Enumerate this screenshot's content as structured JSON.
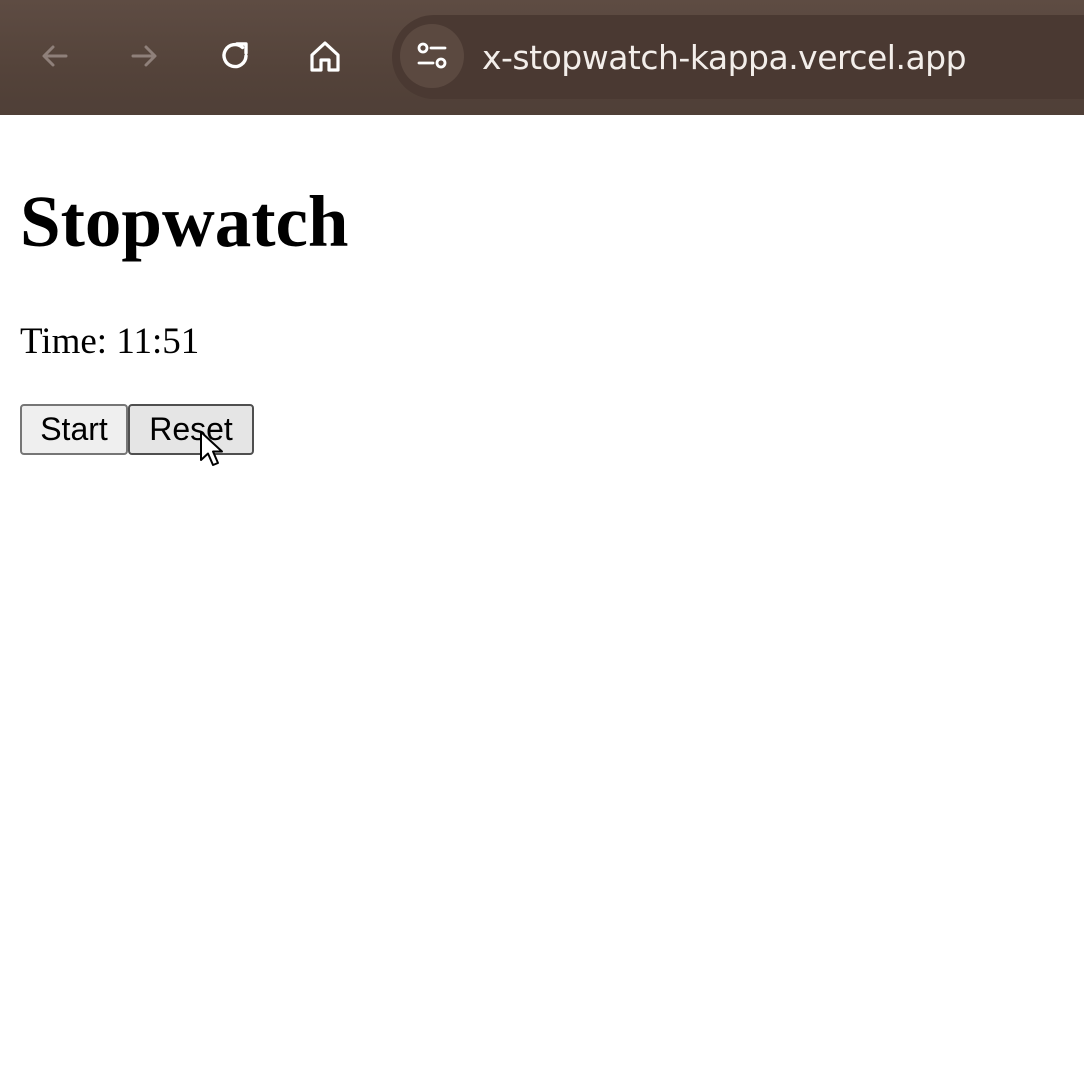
{
  "browser": {
    "url": "x-stopwatch-kappa.vercel.app",
    "icons": {
      "back": "back-arrow-icon",
      "forward": "forward-arrow-icon",
      "reload": "reload-icon",
      "home": "home-icon",
      "site_info": "site-settings-icon"
    },
    "colors": {
      "toolbar": "#5e4c43",
      "url_text": "#f3eeea"
    }
  },
  "page": {
    "title": "Stopwatch",
    "time_label": "Time: ",
    "time_value": "11:51",
    "buttons": {
      "start_label": "Start",
      "reset_label": "Reset"
    }
  }
}
